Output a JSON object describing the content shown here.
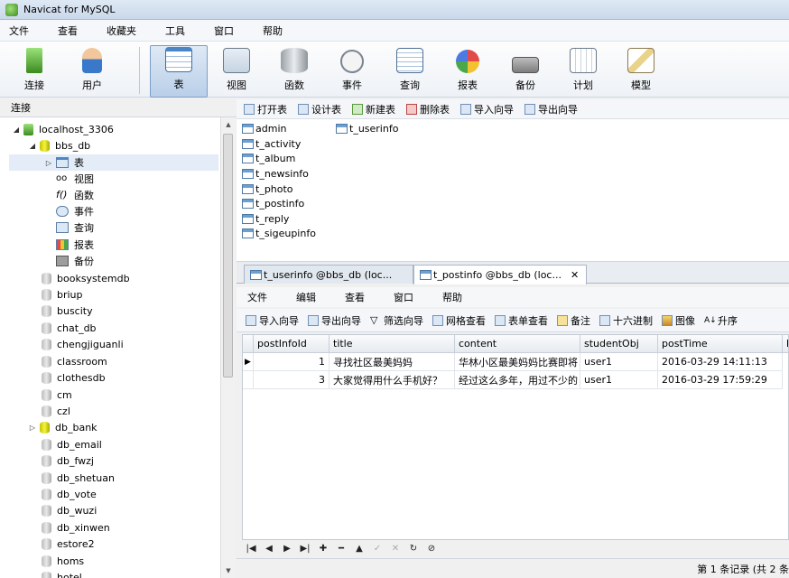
{
  "window": {
    "title": "Navicat for MySQL"
  },
  "menubar": [
    "文件",
    "查看",
    "收藏夹",
    "工具",
    "窗口",
    "帮助"
  ],
  "toolbar": [
    {
      "label": "连接",
      "icon": "connection-icon"
    },
    {
      "label": "用户",
      "icon": "user-icon"
    },
    {
      "label": "表",
      "icon": "table-icon"
    },
    {
      "label": "视图",
      "icon": "view-icon"
    },
    {
      "label": "函数",
      "icon": "function-icon"
    },
    {
      "label": "事件",
      "icon": "event-icon"
    },
    {
      "label": "查询",
      "icon": "query-icon"
    },
    {
      "label": "报表",
      "icon": "report-icon"
    },
    {
      "label": "备份",
      "icon": "backup-icon"
    },
    {
      "label": "计划",
      "icon": "schedule-icon"
    },
    {
      "label": "模型",
      "icon": "model-icon"
    }
  ],
  "connection_bar": {
    "label": "连接"
  },
  "tree": {
    "connection": "localhost_3306",
    "open_db": "bbs_db",
    "children": [
      "表",
      "视图",
      "函数",
      "事件",
      "查询",
      "报表",
      "备份"
    ],
    "databases": [
      "booksystemdb",
      "briup",
      "buscity",
      "chat_db",
      "chengjiguanli",
      "classroom",
      "clothesdb",
      "cm",
      "czl",
      "db_bank",
      "db_email",
      "db_fwzj",
      "db_shetuan",
      "db_vote",
      "db_wuzi",
      "db_xinwen",
      "estore2",
      "homs",
      "hotel"
    ]
  },
  "object_toolbar": [
    "打开表",
    "设计表",
    "新建表",
    "删除表",
    "导入向导",
    "导出向导"
  ],
  "objects": {
    "col1": [
      "admin",
      "t_activity",
      "t_album",
      "t_newsinfo",
      "t_photo",
      "t_postinfo",
      "t_reply",
      "t_sigeupinfo"
    ],
    "col2": [
      "t_userinfo"
    ]
  },
  "tabs": [
    {
      "label": "t_userinfo @bbs_db (loc..."
    },
    {
      "label": "t_postinfo @bbs_db (loc..."
    }
  ],
  "inner_menu": [
    "文件",
    "编辑",
    "查看",
    "窗口",
    "帮助"
  ],
  "inner_toolbar": [
    "导入向导",
    "导出向导",
    "筛选向导",
    "网格查看",
    "表单查看",
    "备注",
    "十六进制",
    "图像",
    "升序"
  ],
  "grid": {
    "columns": [
      "postInfoId",
      "title",
      "content",
      "studentObj",
      "postTime",
      "h"
    ],
    "rows": [
      [
        "1",
        "寻找社区最美妈妈",
        "华林小区最美妈妈比赛即将",
        "user1",
        "2016-03-29 14:11:13"
      ],
      [
        "3",
        "大家觉得用什么手机好？",
        "经过这么多年，用过不少的",
        "user1",
        "2016-03-29 17:59:29"
      ]
    ]
  },
  "status": "第 1 条记录 (共 2 条"
}
